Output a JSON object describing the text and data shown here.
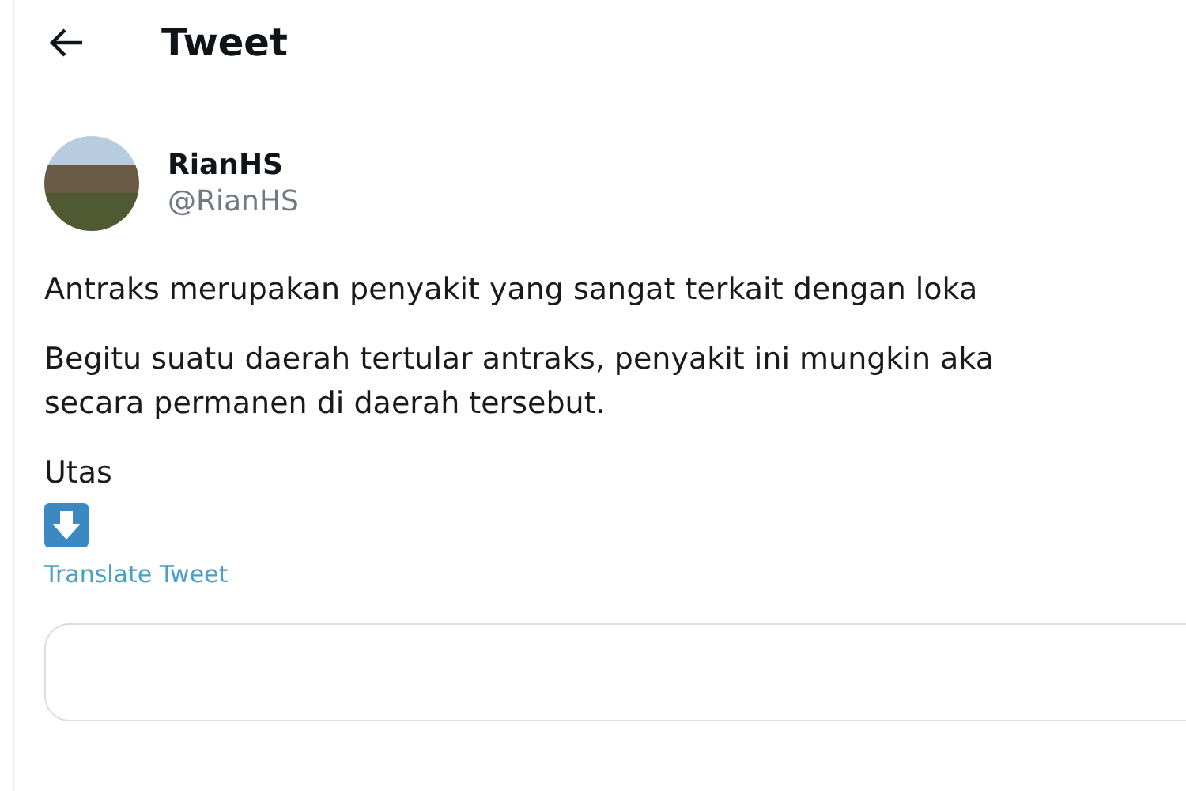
{
  "header": {
    "title": "Tweet"
  },
  "author": {
    "name": "RianHS",
    "handle": "@RianHS"
  },
  "tweet": {
    "paragraphs": [
      [
        "Antraks merupakan penyakit yang sangat terkait dengan loka"
      ],
      [
        "Begitu suatu daerah tertular antraks, penyakit ini mungkin aka",
        "secara permanen di daerah tersebut."
      ],
      [
        "Utas"
      ]
    ],
    "translate_link": "Translate Tweet"
  }
}
